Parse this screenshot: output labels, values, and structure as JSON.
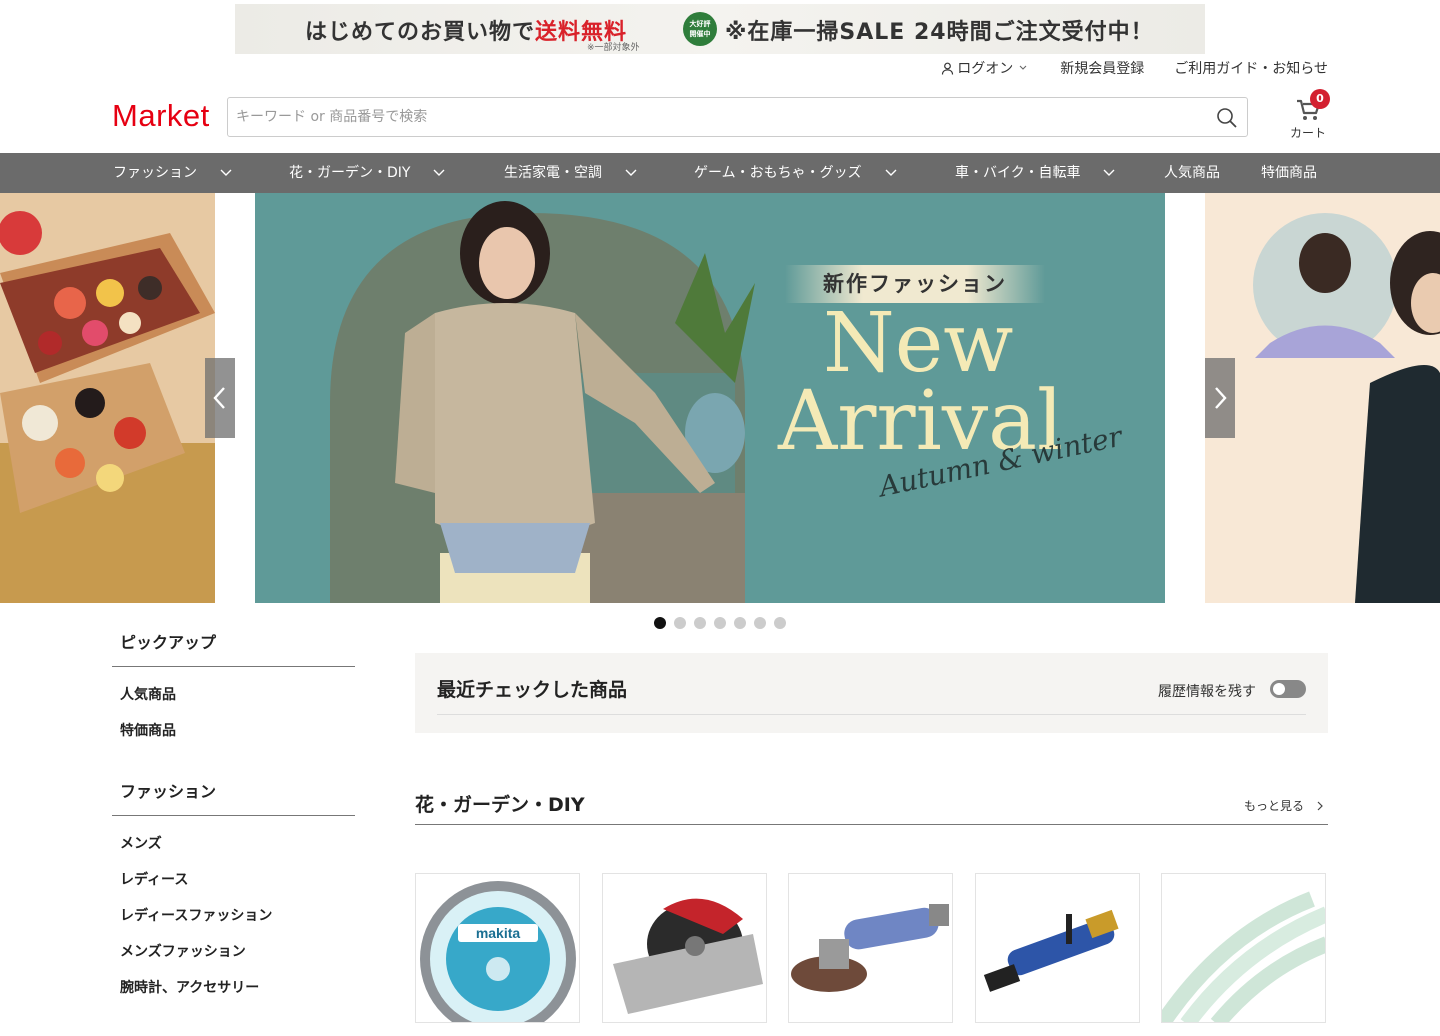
{
  "promo": {
    "left_text_a": "はじめてのお買い物で",
    "left_text_b": "送料無料",
    "note": "※一部対象外",
    "badge_line1": "大好評",
    "badge_line2": "開催中",
    "right_text": "※在庫一掃SALE 24時間ご注文受付中！"
  },
  "toplinks": {
    "login": "ログオン",
    "register": "新規会員登録",
    "guide": "ご利用ガイド・お知らせ"
  },
  "logo": "Market",
  "search": {
    "placeholder": "キーワード or 商品番号で検索",
    "value": ""
  },
  "cart": {
    "count": "0",
    "label": "カート"
  },
  "nav": {
    "items": [
      {
        "label": "ファッション",
        "dropdown": true
      },
      {
        "label": "花・ガーデン・DIY",
        "dropdown": true
      },
      {
        "label": "生活家電・空調",
        "dropdown": true
      },
      {
        "label": "ゲーム・おもちゃ・グッズ",
        "dropdown": true
      },
      {
        "label": "車・バイク・自転車",
        "dropdown": true
      },
      {
        "label": "人気商品",
        "dropdown": false
      },
      {
        "label": "特価商品",
        "dropdown": false
      }
    ]
  },
  "carousel": {
    "slide_title_jp": "新作ファッション",
    "slide_title_en_1": "New",
    "slide_title_en_2": "Arrival",
    "slide_script": "Autumn & winter",
    "dot_count": 7,
    "active_dot": 0
  },
  "sidebar": {
    "groups": [
      {
        "heading": "ピックアップ",
        "items": [
          "人気商品",
          "特価商品"
        ]
      },
      {
        "heading": "ファッション",
        "items": [
          "メンズ",
          "レディース",
          "レディースファッション",
          "メンズファッション",
          "腕時計、アクセサリー"
        ]
      }
    ]
  },
  "recent": {
    "title": "最近チェックした商品",
    "toggle_label": "履歴情報を残す",
    "toggle_on": false
  },
  "section": {
    "title": "花・ガーデン・DIY",
    "more": "もっと見る"
  },
  "products": [
    {
      "icon": "saw-blade-icon"
    },
    {
      "icon": "circular-saw-icon"
    },
    {
      "icon": "angle-grinder-icon"
    },
    {
      "icon": "air-grinder-icon"
    },
    {
      "icon": "hose-icon"
    }
  ],
  "colors": {
    "brand": "#e60012",
    "nav_bg": "#6b6b6b",
    "cart_badge": "#d32030",
    "slide_bg": "#5f9a98",
    "slide_text": "#f4eab6"
  }
}
